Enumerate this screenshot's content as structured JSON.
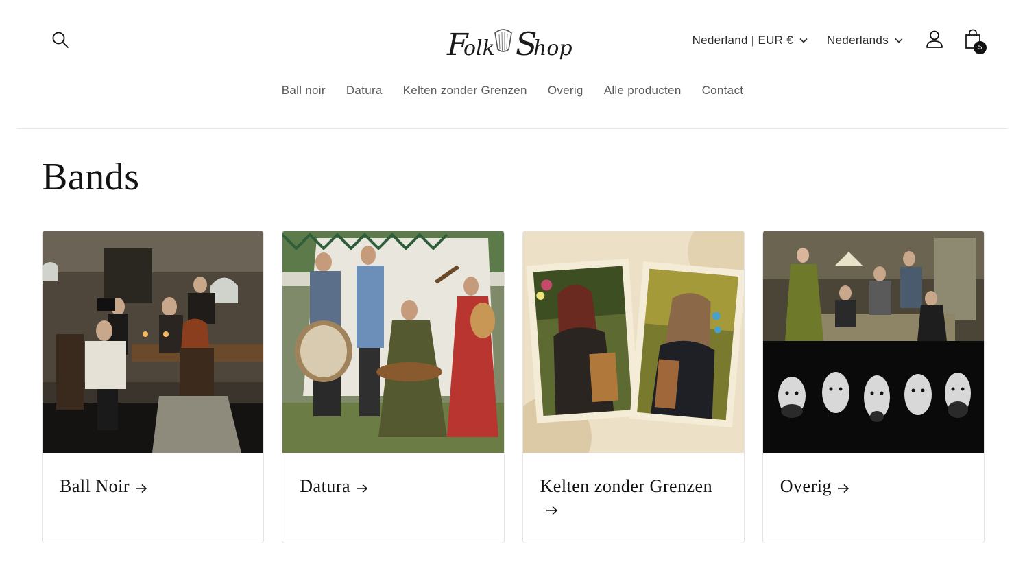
{
  "header": {
    "logo_text": "Folk Shop",
    "country_selector": "Nederland | EUR €",
    "language_selector": "Nederlands",
    "cart_count": "5"
  },
  "nav": {
    "items": [
      {
        "label": "Ball noir"
      },
      {
        "label": "Datura"
      },
      {
        "label": "Kelten zonder Grenzen"
      },
      {
        "label": "Overig"
      },
      {
        "label": "Alle producten"
      },
      {
        "label": "Contact"
      }
    ]
  },
  "main": {
    "title": "Bands",
    "collections": [
      {
        "title": "Ball Noir",
        "image": "ball-noir-band-photo"
      },
      {
        "title": "Datura",
        "image": "datura-band-photo"
      },
      {
        "title": "Kelten zonder Grenzen",
        "image": "kelten-zonder-grenzen-photo"
      },
      {
        "title": "Overig",
        "image": "overig-band-photos"
      }
    ]
  },
  "icons": {
    "search": "search-icon",
    "chevron": "chevron-down-icon",
    "account": "user-icon",
    "cart": "shopping-bag-icon",
    "arrow": "arrow-right-icon"
  },
  "colors": {
    "text": "#121212",
    "nav_text": "#5a5a5a",
    "border": "#e4e4e4"
  }
}
